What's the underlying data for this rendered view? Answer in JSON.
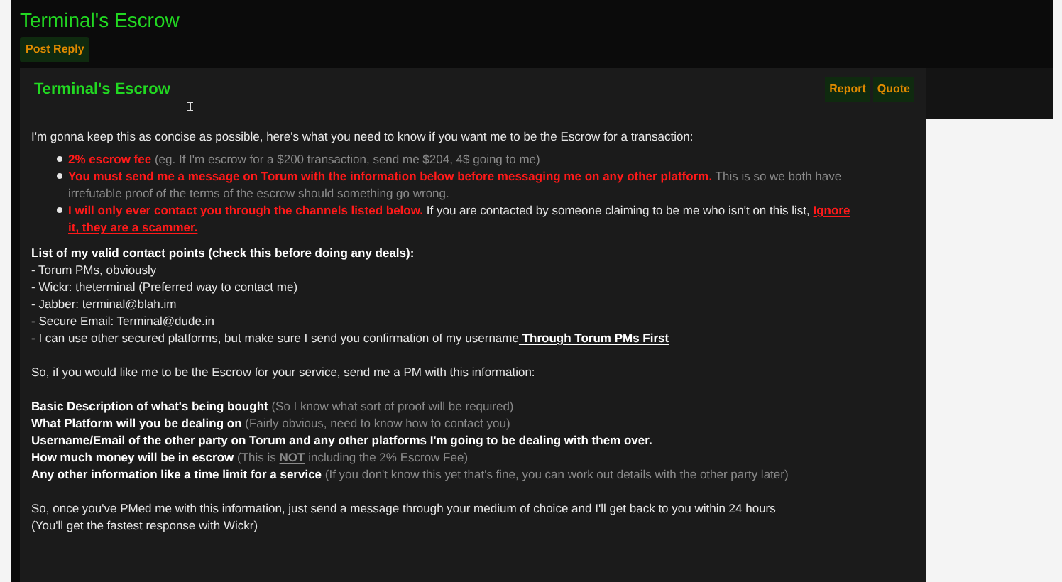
{
  "thread_title": "Terminal's Escrow",
  "post_reply_button": "Post Reply",
  "post": {
    "title": "Terminal's Escrow",
    "actions": [
      "Report",
      "Quote"
    ],
    "intro": "I'm gonna keep this as concise as possible, here's what you need to know if you want me to be the Escrow for a transaction:",
    "bullets": [
      [
        {
          "kind": "alert",
          "text": "2% escrow fee"
        },
        {
          "kind": "note",
          "text": " (eg. If I'm escrow for a $200 transaction, send me $204, 4$ going to me)"
        }
      ],
      [
        {
          "kind": "alert",
          "text": "You must send me a message on Torum with the information below before messaging me on any other platform."
        },
        {
          "kind": "note",
          "text": " This is so we both have irrefutable proof of the terms of the escrow should something go wrong."
        }
      ],
      [
        {
          "kind": "alert",
          "text": "I will only ever contact you through the channels listed below."
        },
        {
          "kind": "plain",
          "text": " If you are contacted by someone claiming to be me who isn't on this list, "
        },
        {
          "kind": "alert-underline",
          "text": "Ignore it, they are a scammer."
        }
      ]
    ],
    "contacts_heading": "List of my valid contact points (check this before doing any deals):",
    "contacts": [
      [
        {
          "kind": "plain",
          "text": "- Torum PMs, obviously"
        }
      ],
      [
        {
          "kind": "plain",
          "text": "- Wickr: theterminal (Preferred way to contact me)"
        }
      ],
      [
        {
          "kind": "plain",
          "text": "- Jabber: terminal@blah.im"
        }
      ],
      [
        {
          "kind": "plain",
          "text": "- Secure Email: Terminal@dude.in"
        }
      ],
      [
        {
          "kind": "plain",
          "text": "- I can use other secured platforms, but make sure I send you confirmation of my username"
        },
        {
          "kind": "strong-underline",
          "text": " Through Torum PMs First"
        }
      ]
    ],
    "request": "So, if you would like me to be the Escrow for your service, send me a PM with this information:",
    "info": [
      [
        {
          "kind": "strong",
          "text": "Basic Description of what's being bought"
        },
        {
          "kind": "note",
          "text": " (So I know what sort of proof will be required)"
        }
      ],
      [
        {
          "kind": "strong",
          "text": "What Platform will you be dealing on"
        },
        {
          "kind": "note",
          "text": " (Fairly obvious, need to know how to contact you)"
        }
      ],
      [
        {
          "kind": "strong",
          "text": "Username/Email of the other party on Torum and any other platforms I'm going to be dealing with them over."
        }
      ],
      [
        {
          "kind": "strong",
          "text": "How much money will be in escrow"
        },
        {
          "kind": "note",
          "text": " (This is "
        },
        {
          "kind": "note-underline",
          "text": "NOT"
        },
        {
          "kind": "note",
          "text": " including the 2% Escrow Fee)"
        }
      ],
      [
        {
          "kind": "strong",
          "text": "Any other information like a time limit for a service"
        },
        {
          "kind": "note",
          "text": " (If you don't know this yet that's fine, you can work out details with the other party later)"
        }
      ]
    ],
    "closing": [
      "So, once you've PMed me with this information, just send a message through your medium of choice and I'll get back to you within 24 hours",
      "(You'll get the fastest response with Wickr)"
    ]
  }
}
